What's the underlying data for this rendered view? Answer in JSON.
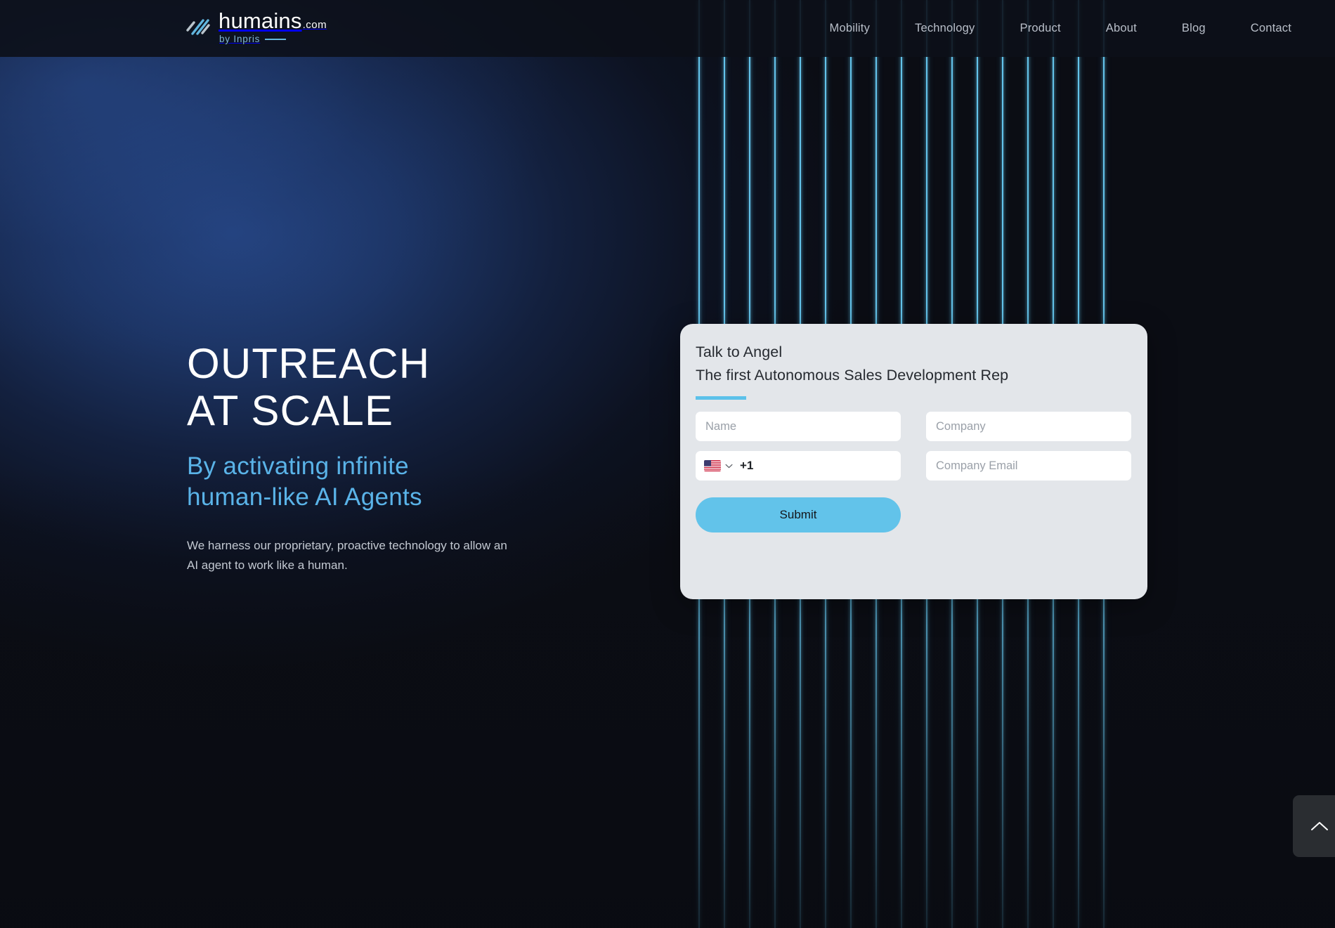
{
  "brand": {
    "name": "humains",
    "tld": ".com",
    "tagline": "by Inpris",
    "logo_icon": "diagonal-stripes-logo-icon",
    "accent_color": "#62c3ea"
  },
  "nav": {
    "items": [
      {
        "label": "Mobility"
      },
      {
        "label": "Technology"
      },
      {
        "label": "Product"
      },
      {
        "label": "About"
      },
      {
        "label": "Blog"
      },
      {
        "label": "Contact"
      }
    ]
  },
  "hero": {
    "headline": "OUTREACH\nAT SCALE",
    "subheadline": "By activating infinite\nhuman-like AI Agents",
    "body": "We harness our proprietary, proactive technology to allow an\nAI agent to work like a human.",
    "headline_color": "#ffffff",
    "subheadline_color": "#5ab3e8"
  },
  "form": {
    "title": "Talk to Angel",
    "subtitle": "The first Autonomous Sales Development Rep",
    "accent_rule_color": "#5cc1ea",
    "fields": {
      "name_placeholder": "Name",
      "company_placeholder": "Company",
      "company_email_placeholder": "Company Email",
      "phone_dial_code": "+1",
      "phone_country_flag": "us-flag-icon",
      "phone_dropdown_icon": "chevron-down-icon"
    },
    "submit_label": "Submit",
    "submit_color": "#62c3ea",
    "card_background": "#e3e6ea"
  },
  "scroll_top": {
    "icon": "chevron-up-icon",
    "label": "Scroll to top"
  },
  "background": {
    "line_color": "#63c3ea",
    "line_count": 17,
    "line_spacing_px": 36,
    "glow_color": "#284a8c",
    "base_color": "#0b0d14"
  }
}
